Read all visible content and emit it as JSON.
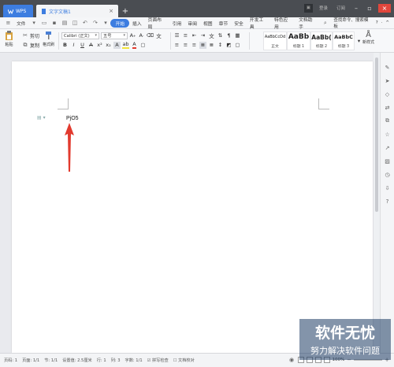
{
  "titlebar": {
    "app_tab_label": "WPS",
    "doc_tab_label": "文字文稿1",
    "new_tab_symbol": "+",
    "right_buttons": [
      "登录",
      "订阅"
    ]
  },
  "menubar": {
    "file_label": "文件",
    "items": [
      "开始",
      "插入",
      "页面布局",
      "引用",
      "审阅",
      "视图",
      "章节",
      "安全",
      "开发工具",
      "特色应用",
      "文档助手"
    ],
    "active_item": "开始",
    "search_label": "查找命令、搜索模板",
    "right_symbols": [
      "?",
      "·",
      "^"
    ]
  },
  "ribbon": {
    "paste_label": "粘贴",
    "cut_label": "剪切",
    "copy_label": "复制",
    "format_painter_label": "格式刷",
    "font_name": "Calibri (正文)",
    "font_size": "五号",
    "style_gallery": [
      {
        "preview": "AaBbCcDd",
        "name": "正文"
      },
      {
        "preview": "AaBb",
        "name": "标题 1"
      },
      {
        "preview": "AaBb(",
        "name": "标题 2"
      },
      {
        "preview": "AaBbC",
        "name": "标题 3"
      }
    ],
    "new_style_label": "新样式"
  },
  "document": {
    "text": "PjO5"
  },
  "statusbar": {
    "items": [
      "页码: 1",
      "页面: 1/1",
      "节: 1/1",
      "设置值: 2.5厘米",
      "行: 1",
      "列: 3",
      "字数: 1/1",
      "拼写检查",
      "文档校对"
    ],
    "zoom": "100%",
    "zoom_minus": "−",
    "zoom_plus": "+"
  },
  "watermark": {
    "line1": "软件无忧",
    "line2": "努力解决软件问题"
  },
  "colors": {
    "titlebar_bg": "#4a4d52",
    "accent": "#3d7de0",
    "close_red": "#e0463c",
    "arrow_red": "#e23a2e"
  }
}
